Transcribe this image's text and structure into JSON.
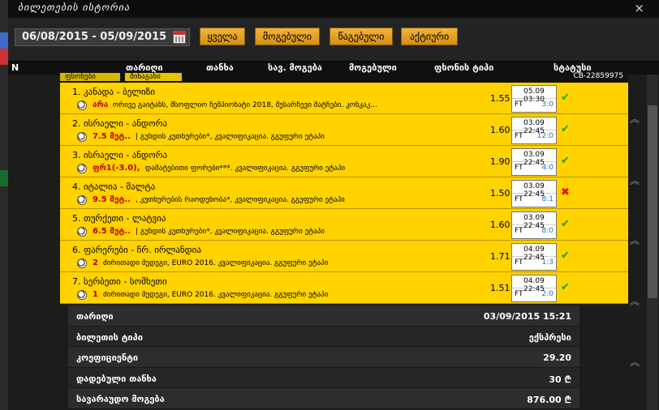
{
  "window": {
    "title": "ბილეთების ისტორია",
    "close_glyph": "×"
  },
  "filter": {
    "date_range": "06/08/2015 - 05/09/2015",
    "buttons": [
      "ყველა",
      "მოგებული",
      "წაგებული",
      "აქტიური"
    ]
  },
  "columns": [
    "N",
    "თარიღი",
    "თანხა",
    "სავ. მოგება",
    "მოგებული",
    "ფსონის ტიპი",
    "სტატუსი"
  ],
  "tabs": {
    "tab1": "ფსონები",
    "tab2": "შინაგანი",
    "code": "CB-22859975"
  },
  "bets": [
    {
      "match": "1. კანადა - ბელიზი",
      "pick": "არა",
      "desc": "ორივე გაიტანს, მსოფლიო ჩემპიონატი 2018, შესარჩევი მატჩები. კონკაკ...",
      "odd": "1.55",
      "date": "05.09 03:30",
      "status": "FT",
      "score": "3:0",
      "result": "win"
    },
    {
      "match": "2. ისრაელი - ანდორა",
      "pick": "7.5 მეტ..",
      "desc": "| გუნდის კუთხურები*, კვალიფიკაცია. გგუფური ეტაპი",
      "odd": "1.60",
      "date": "03.09 22:45",
      "status": "FT",
      "score": "12:0",
      "result": "win"
    },
    {
      "match": "3. ისრაელი - ანდორა",
      "pick": "ფრ1(-3.0),",
      "desc": "დამატებითი ფორები***. კვალიფიკაცია. გგუფური ეტაპი",
      "odd": "1.90",
      "date": "03.09 22:45",
      "status": "FT",
      "score": "4:0",
      "result": "win"
    },
    {
      "match": "4. იტალია - მალტა",
      "pick": "9.5 მეტ..",
      "desc": ", კუთხურების რაოდენობა*, კვალიფიკაცია. გგუფური ეტაპი",
      "odd": "1.50",
      "date": "03.09 22:45",
      "status": "FT",
      "score": "8:1",
      "result": "lose"
    },
    {
      "match": "5. თურქეთი - ლატვია",
      "pick": "6.5 მეტ..",
      "desc": "| გუნდის კუთხურები*, კვალიფიკაცია. გგუფური ეტაპი",
      "odd": "1.60",
      "date": "03.09 22:45",
      "status": "FT",
      "score": "8:0",
      "result": "win"
    },
    {
      "match": "6. ფარერები - ჩრ. ირლანდია",
      "pick": "2",
      "desc": "ძირითადი შედეგი, EURO 2016. კვალიფიკაცია. გგუფური ეტაპი",
      "odd": "1.71",
      "date": "04.09 22:45",
      "status": "FT",
      "score": "1:3",
      "result": "win"
    },
    {
      "match": "7. სერბეთი - სომხეთი",
      "pick": "1",
      "desc": "ძირითადი შედეგი, EURO 2016. კვალიფიკაცია. გგუფური ეტაპი",
      "odd": "1.51",
      "date": "04.09 22:45",
      "status": "FT",
      "score": "2:0",
      "result": "win"
    }
  ],
  "summary": [
    {
      "label": "თარიღი",
      "value": "03/09/2015 15:21"
    },
    {
      "label": "ბილეთის ტიპი",
      "value": "ექსპრესი"
    },
    {
      "label": "კოეფიციენტი",
      "value": "29.20"
    },
    {
      "label": "დადებული თანხა",
      "value": "30 ₾"
    },
    {
      "label": "სავარაუდო მოგება",
      "value": "876.00 ₾"
    }
  ],
  "glyphs": {
    "check": "✔",
    "cross": "✖",
    "scroll_up": "︽"
  },
  "colors": {
    "accent": "#ffd200",
    "win": "#1aa31a",
    "lose": "#e00000",
    "pick": "#c00000"
  }
}
